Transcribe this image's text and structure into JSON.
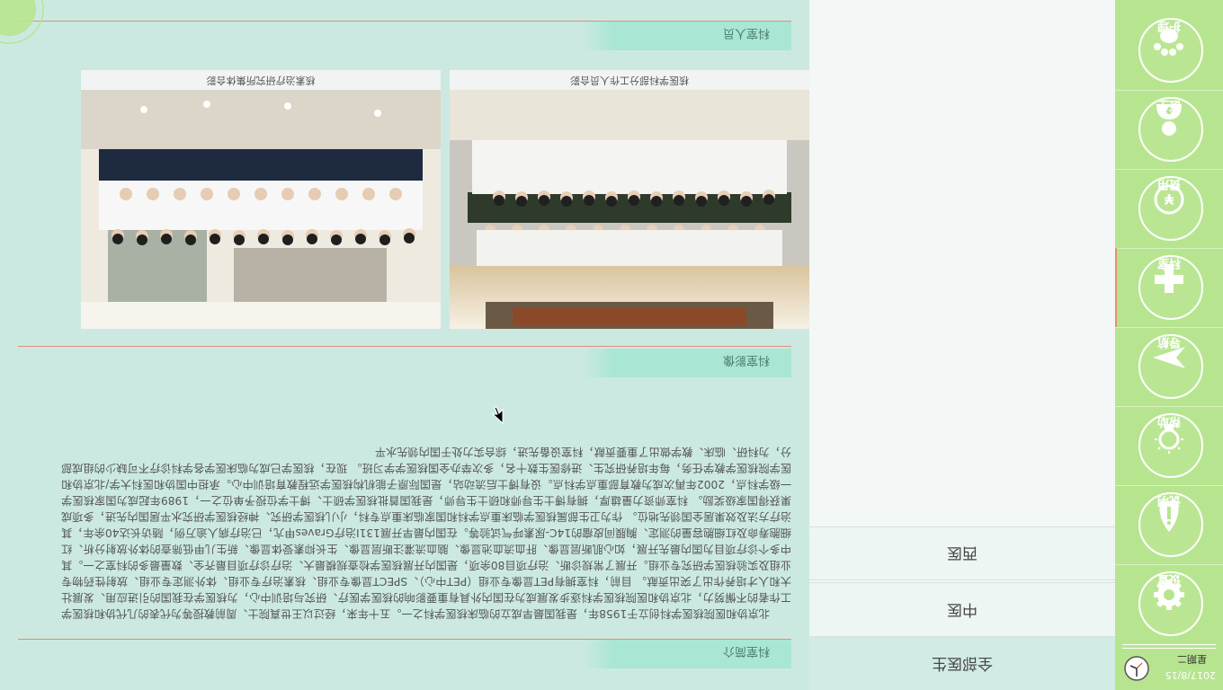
{
  "clock": {
    "date": "2017/8/15",
    "weekday": "星期二"
  },
  "sidebar": {
    "items": [
      {
        "label": "设置"
      },
      {
        "label": "说明"
      },
      {
        "label": "帮助"
      },
      {
        "label": "导航"
      },
      {
        "label": "科室"
      },
      {
        "label": "费用"
      },
      {
        "label": "医生"
      },
      {
        "label": "护理"
      }
    ]
  },
  "subnav": {
    "items": [
      {
        "label": "西医"
      },
      {
        "label": "中医"
      },
      {
        "label": "全部医生"
      }
    ]
  },
  "sections": {
    "intro_title": "科室简介",
    "image_title": "科室影像",
    "staff_title": "科室人员"
  },
  "intro": {
    "text": "北京协和医院核医学科创立于1958年，是我国最早成立的临床核医学科之一。五十年来，经过以王世真院士、周前教授等为代表的几代协和核医学工作者的不懈努力，北京协和医院核医学科逐步发展成为在国内外具有重要影响的核医学医疗、研究与培训中心，为核医学在我国的引进应用、发展壮大和人才培养作出了突出贡献。 目前，科室拥有PET显像专业组（PET中心）、SPECT显像专业组、核素治疗专业组、体外测定专业组、放射性药物专业组及实验核医学研究专业组。开展了常规诊断、治疗项目80余项，是国内开展核医学检查规模最大、治疗诊疗项目最齐全、数量最多的科室之一。其中多个诊疗项目为国内最先开展，如心肌断层显像、肝血流血池显像、脑血流灌注断层显像、生长抑素受体显像、新生儿甲低筛查的体外放射分析、红细胞寿命及红细胞容量的测定、胸膜间皮瘤的14C-尿素呼气试验等。在国内最早开展131I治疗Graves甲亢，已治疗病人逾万例，随访长达40余年，其治疗方法及效果居全国领先地位。 作为卫生部属核医学临床重点学科和国家临床重点专科，小儿核医学研究、神经核医学研究水平居国内先进，多项成果获得国家级奖励。 科室师资力量雄厚，拥有博士生导师和硕士生导师，是我国首批核医学硕士、博士学位授予单位之一，1989年起成为国家核医学一级学科点，2002年再次成为教育部重点学科点。设有博士后流动站，是国际原子能机构核医学远程教育培训中心。承担中国协和医科大学/北京协和医学院核医学教学任务，每年培养研究生、进修医生数十名，多次举办全国核医学学习班。 现在，核医学已成为临床医学各学科诊疗不可缺少的组成部分，为科研、临床、教学做出了重要贡献，科室设备先进，综合实力处于国内领先水平"
  },
  "photos": [
    {
      "caption": "核医学科部分工作人员合影"
    },
    {
      "caption": "核素治疗研究所集体合影"
    }
  ]
}
